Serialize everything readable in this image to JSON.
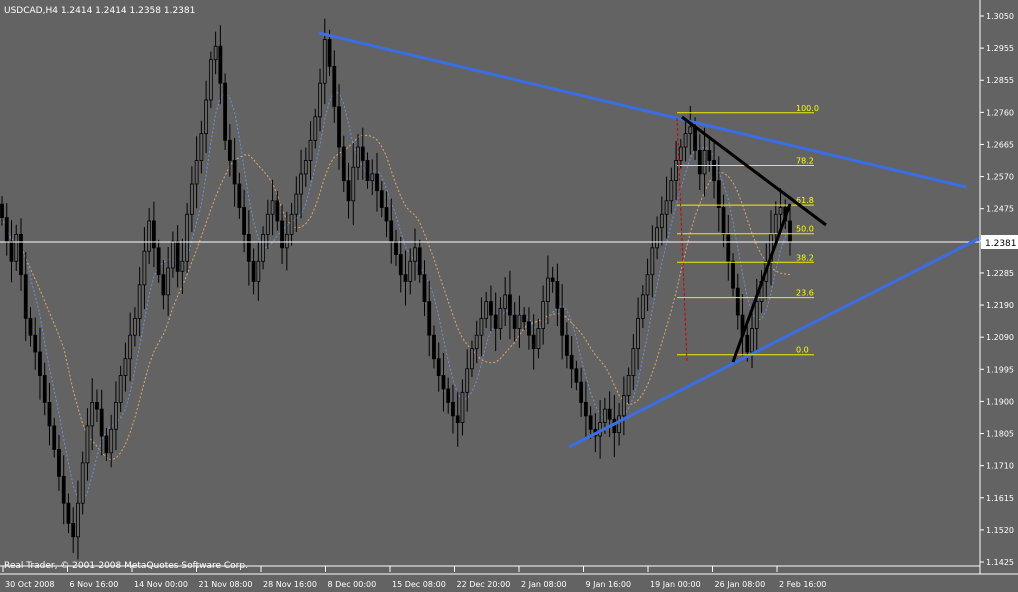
{
  "header": {
    "title": "USDCAD,H4  1.2414 1.2414 1.2358 1.2381"
  },
  "copyright": "Real Trader, © 2001-2008 MetaQuotes Software Corp.",
  "current_price": "1.2381",
  "colors": {
    "background": "#636363",
    "candles": "#000000",
    "trendline": "#3b6ee6",
    "fib": "#f0f000",
    "fib_text": "#ffff00",
    "ma_fast": "#6f8fd6",
    "ma_slow": "#e2a56b",
    "price_line": "#ffffff",
    "axis_text": "#ffffff"
  },
  "chart_data": {
    "type": "candlestick",
    "symbol": "USDCAD",
    "timeframe": "H4",
    "ylim": [
      1.1425,
      1.305
    ],
    "y_ticks": [
      "1.3050",
      "1.2955",
      "1.2855",
      "1.2760",
      "1.2665",
      "1.2570",
      "1.2475",
      "1.2381",
      "1.2285",
      "1.2190",
      "1.2090",
      "1.1995",
      "1.1900",
      "1.1805",
      "1.1710",
      "1.1615",
      "1.1520",
      "1.1425"
    ],
    "x_ticks": [
      "30 Oct 2008",
      "6 Nov 16:00",
      "14 Nov 00:00",
      "21 Nov 08:00",
      "28 Nov 16:00",
      "8 Dec 00:00",
      "15 Dec 08:00",
      "22 Dec 20:00",
      "2 Jan 08:00",
      "9 Jan 16:00",
      "19 Jan 00:00",
      "26 Jan 08:00",
      "2 Feb 16:00"
    ],
    "fib_levels": [
      {
        "label": "100.0",
        "value": 1.2762
      },
      {
        "label": "78.2",
        "value": 1.2605
      },
      {
        "label": "61.8",
        "value": 1.2487
      },
      {
        "label": "50.0",
        "value": 1.2402
      },
      {
        "label": "38.2",
        "value": 1.2317
      },
      {
        "label": "23.6",
        "value": 1.2212
      },
      {
        "label": "0.0",
        "value": 1.2042
      }
    ],
    "closes": [
      1.245,
      1.238,
      1.232,
      1.24,
      1.228,
      1.215,
      1.21,
      1.205,
      1.198,
      1.19,
      1.183,
      1.176,
      1.168,
      1.16,
      1.154,
      1.15,
      1.16,
      1.172,
      1.183,
      1.19,
      1.188,
      1.18,
      1.175,
      1.182,
      1.19,
      1.198,
      1.203,
      1.21,
      1.215,
      1.225,
      1.235,
      1.244,
      1.236,
      1.228,
      1.222,
      1.23,
      1.238,
      1.229,
      1.232,
      1.246,
      1.255,
      1.262,
      1.27,
      1.28,
      1.292,
      1.296,
      1.285,
      1.268,
      1.262,
      1.255,
      1.248,
      1.24,
      1.232,
      1.226,
      1.232,
      1.24,
      1.246,
      1.25,
      1.244,
      1.236,
      1.24,
      1.246,
      1.252,
      1.258,
      1.262,
      1.268,
      1.275,
      1.285,
      1.298,
      1.29,
      1.278,
      1.266,
      1.256,
      1.25,
      1.26,
      1.266,
      1.262,
      1.256,
      1.258,
      1.253,
      1.248,
      1.244,
      1.238,
      1.234,
      1.228,
      1.226,
      1.232,
      1.236,
      1.228,
      1.22,
      1.21,
      1.203,
      1.198,
      1.194,
      1.19,
      1.186,
      1.184,
      1.193,
      1.2,
      1.206,
      1.21,
      1.215,
      1.22,
      1.216,
      1.212,
      1.218,
      1.222,
      1.216,
      1.212,
      1.216,
      1.214,
      1.21,
      1.206,
      1.212,
      1.22,
      1.227,
      1.226,
      1.218,
      1.21,
      1.204,
      1.2,
      1.196,
      1.19,
      1.186,
      1.182,
      1.18,
      1.184,
      1.188,
      1.185,
      1.181,
      1.186,
      1.192,
      1.198,
      1.206,
      1.215,
      1.222,
      1.228,
      1.236,
      1.242,
      1.246,
      1.25,
      1.256,
      1.262,
      1.266,
      1.27,
      1.272,
      1.265,
      1.258,
      1.265,
      1.262,
      1.256,
      1.248,
      1.24,
      1.232,
      1.224,
      1.216,
      1.21,
      1.205,
      1.212,
      1.22,
      1.226,
      1.232,
      1.24,
      1.246,
      1.248,
      1.244,
      1.238
    ]
  }
}
